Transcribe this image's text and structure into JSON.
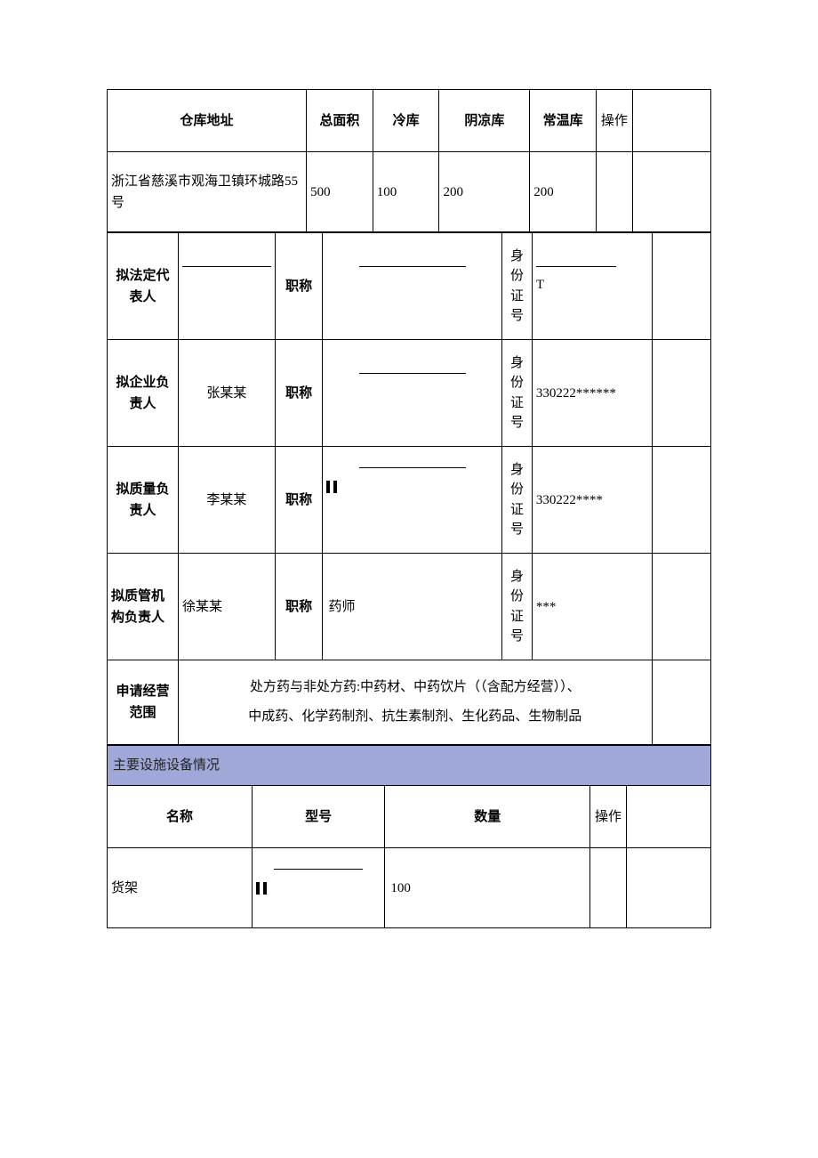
{
  "warehouse": {
    "headers": {
      "address": "仓库地址",
      "total_area": "总面积",
      "cold_storage": "冷库",
      "cool_storage": "阴凉库",
      "normal_storage": "常温库",
      "operation": "操作"
    },
    "address": "浙江省慈溪市观海卫镇环城路55 号",
    "total_area": "500",
    "cold_storage": "100",
    "cool_storage": "200",
    "normal_storage": "200"
  },
  "persons": {
    "title_label": "职称",
    "id_label": "身份证号",
    "legal_rep": {
      "label": "拟法定代表人",
      "name": "",
      "title": "",
      "id": "T"
    },
    "enterprise_head": {
      "label": "拟企业负责人",
      "name": "张某某",
      "title": "",
      "id": "330222******"
    },
    "quality_head": {
      "label": "拟质量负责人",
      "name": "李某某",
      "title": "",
      "id": "330222****"
    },
    "qc_org_head": {
      "label": "拟质管机构负责人",
      "name": "徐某某",
      "title": "药师",
      "id": "***"
    }
  },
  "business_scope": {
    "label": "申请经营范围",
    "line1": "处方药与非处方药:中药材、中药饮片（（含配方经营））、",
    "line2": "中成药、化学药制剂、抗生素制剂、生化药品、生物制品"
  },
  "equipment": {
    "section_title": "主要设施设备情况",
    "headers": {
      "name": "名称",
      "model": "型号",
      "quantity": "数量",
      "operation": "操作"
    },
    "items": [
      {
        "name": "货架",
        "model": "",
        "quantity": "100"
      }
    ]
  }
}
